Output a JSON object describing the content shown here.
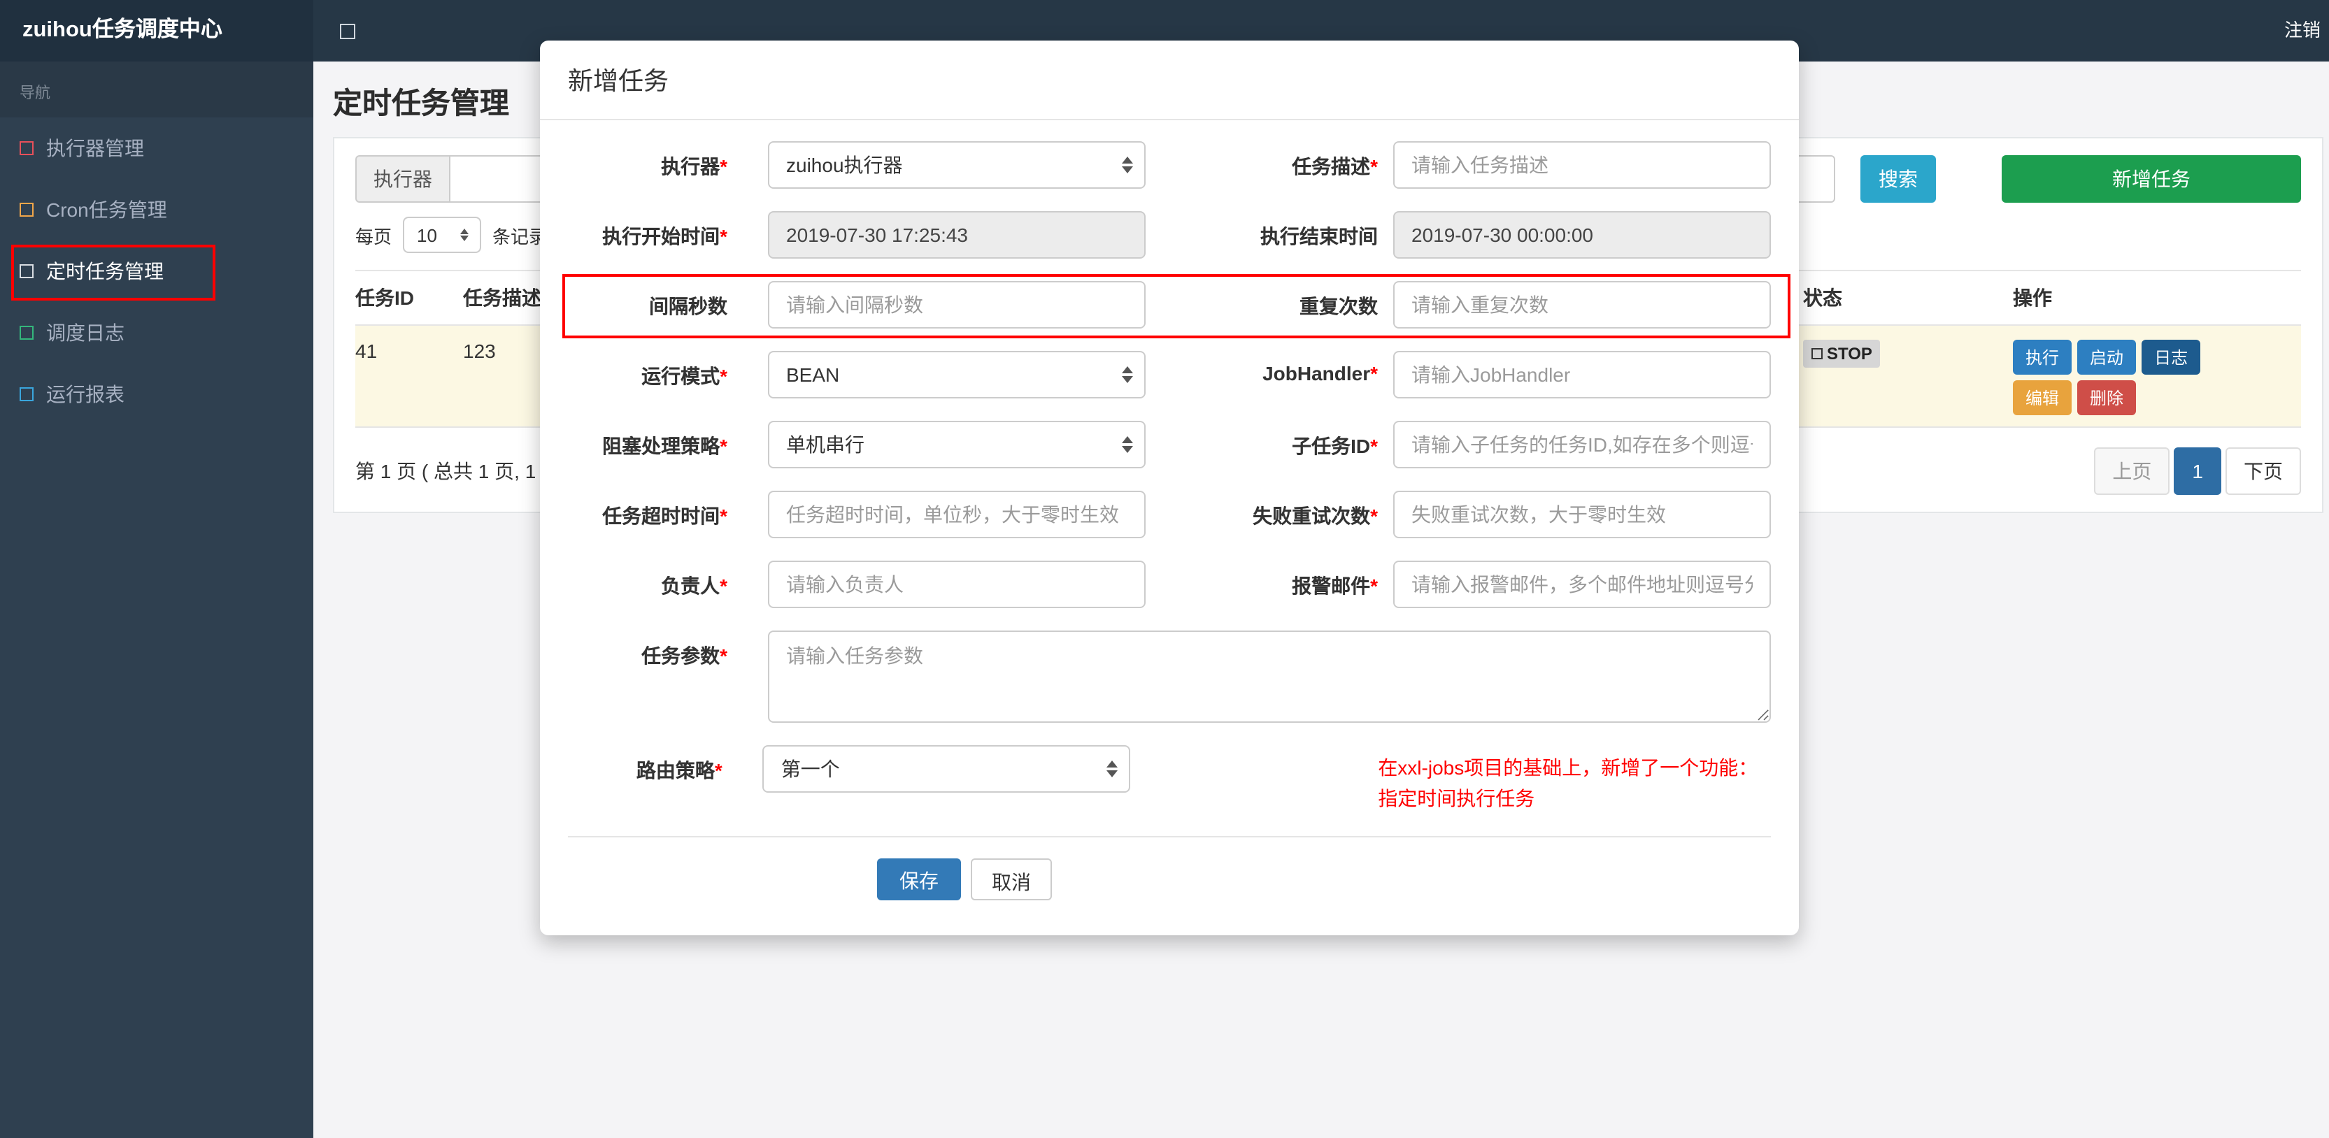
{
  "topbar": {
    "brand": "zuihou任务调度中心",
    "logout": "注销"
  },
  "sidebar": {
    "nav_label": "导航",
    "items": [
      {
        "label": "执行器管理",
        "icon_color": "#e7505a"
      },
      {
        "label": "Cron任务管理",
        "icon_color": "#f0a64a"
      },
      {
        "label": "定时任务管理",
        "icon_color": "#d9dde2"
      },
      {
        "label": "调度日志",
        "icon_color": "#34b77c"
      },
      {
        "label": "运行报表",
        "icon_color": "#3aa6dd"
      }
    ]
  },
  "page": {
    "title": "定时任务管理",
    "filter": {
      "executor_label": "执行器",
      "search_button": "搜索",
      "search_color": "#2ba6cb",
      "add_button": "新增任务",
      "add_color": "#1c9e4f"
    },
    "per_page": {
      "prefix": "每页",
      "value": "10",
      "suffix": "条记录"
    },
    "table": {
      "headers": {
        "id": "任务ID",
        "desc": "任务描述",
        "status": "状态",
        "actions": "操作"
      },
      "row": {
        "id": "41",
        "desc": "123",
        "status": "STOP",
        "status_bg": "#d6d6d6",
        "bg": "#fcf8e3",
        "buttons": [
          {
            "label": "执行",
            "color": "#2d7fc1"
          },
          {
            "label": "启动",
            "color": "#2d7fc1"
          },
          {
            "label": "日志",
            "color": "#1d5b8e"
          },
          {
            "label": "编辑",
            "color": "#e8a33d"
          },
          {
            "label": "删除",
            "color": "#cf4e48"
          }
        ]
      }
    },
    "pagination": {
      "info": "第 1 页 ( 总共 1 页, 1",
      "prev": "上页",
      "current": "1",
      "next": "下页",
      "active_color": "#2e6da4"
    }
  },
  "modal": {
    "title": "新增任务",
    "executor": {
      "label": "执行器",
      "required": "*",
      "value": "zuihou执行器"
    },
    "job_desc": {
      "label": "任务描述",
      "required": "*",
      "placeholder": "请输入任务描述"
    },
    "start_time": {
      "label": "执行开始时间",
      "required": "*",
      "value": "2019-07-30 17:25:43"
    },
    "end_time": {
      "label": "执行结束时间",
      "value": "2019-07-30 00:00:00"
    },
    "interval": {
      "label": "间隔秒数",
      "placeholder": "请输入间隔秒数"
    },
    "repeat": {
      "label": "重复次数",
      "placeholder": "请输入重复次数"
    },
    "run_mode": {
      "label": "运行模式",
      "required": "*",
      "value": "BEAN"
    },
    "job_handler": {
      "label": "JobHandler",
      "required": "*",
      "placeholder": "请输入JobHandler"
    },
    "block_strategy": {
      "label": "阻塞处理策略",
      "required": "*",
      "value": "单机串行"
    },
    "child_job": {
      "label": "子任务ID",
      "required": "*",
      "placeholder": "请输入子任务的任务ID,如存在多个则逗号分隔"
    },
    "timeout": {
      "label": "任务超时时间",
      "required": "*",
      "placeholder": "任务超时时间，单位秒，大于零时生效"
    },
    "retry": {
      "label": "失败重试次数",
      "required": "*",
      "placeholder": "失败重试次数，大于零时生效"
    },
    "owner": {
      "label": "负责人",
      "required": "*",
      "placeholder": "请输入负责人"
    },
    "alarm_email": {
      "label": "报警邮件",
      "required": "*",
      "placeholder": "请输入报警邮件，多个邮件地址则逗号分隔"
    },
    "job_param": {
      "label": "任务参数",
      "required": "*",
      "placeholder": "请输入任务参数"
    },
    "route_strategy": {
      "label": "路由策略",
      "required": "*",
      "value": "第一个"
    },
    "note_line1": "在xxl-jobs项目的基础上，新增了一个功能：",
    "note_line2": "指定时间执行任务",
    "save_button": "保存",
    "cancel_button": "取消"
  },
  "annotation": {
    "color": "#ff0000"
  }
}
